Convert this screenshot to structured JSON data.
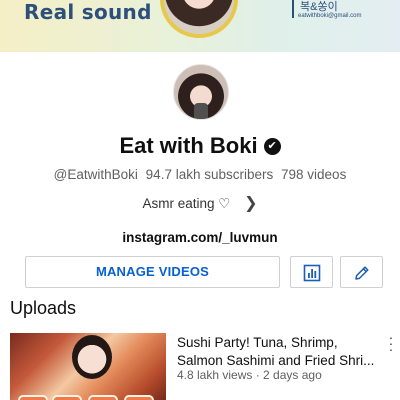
{
  "banner": {
    "text": "Real sound",
    "korean": "복&쏭이",
    "handle": "eatwithboki@gmail.com"
  },
  "channel": {
    "name": "Eat with Boki",
    "verified_icon": "checkmark-icon",
    "handle": "@EatwithBoki",
    "subscribers": "94.7 lakh subscribers",
    "videos": "798 videos",
    "description": "Asmr eating ♡",
    "link": "instagram.com/_luvmun"
  },
  "actions": {
    "manage_label": "MANAGE VIDEOS",
    "analytics_icon": "analytics-icon",
    "edit_icon": "pencil-icon"
  },
  "section": {
    "title": "Uploads"
  },
  "videos": [
    {
      "title": "Sushi Party! Tuna, Shrimp, Salmon Sashimi and Fried Shri...",
      "meta": "4.8 lakh views · 2 days ago"
    }
  ],
  "colors": {
    "accent": "#065fd4",
    "banner_text": "#2d4f7c"
  }
}
